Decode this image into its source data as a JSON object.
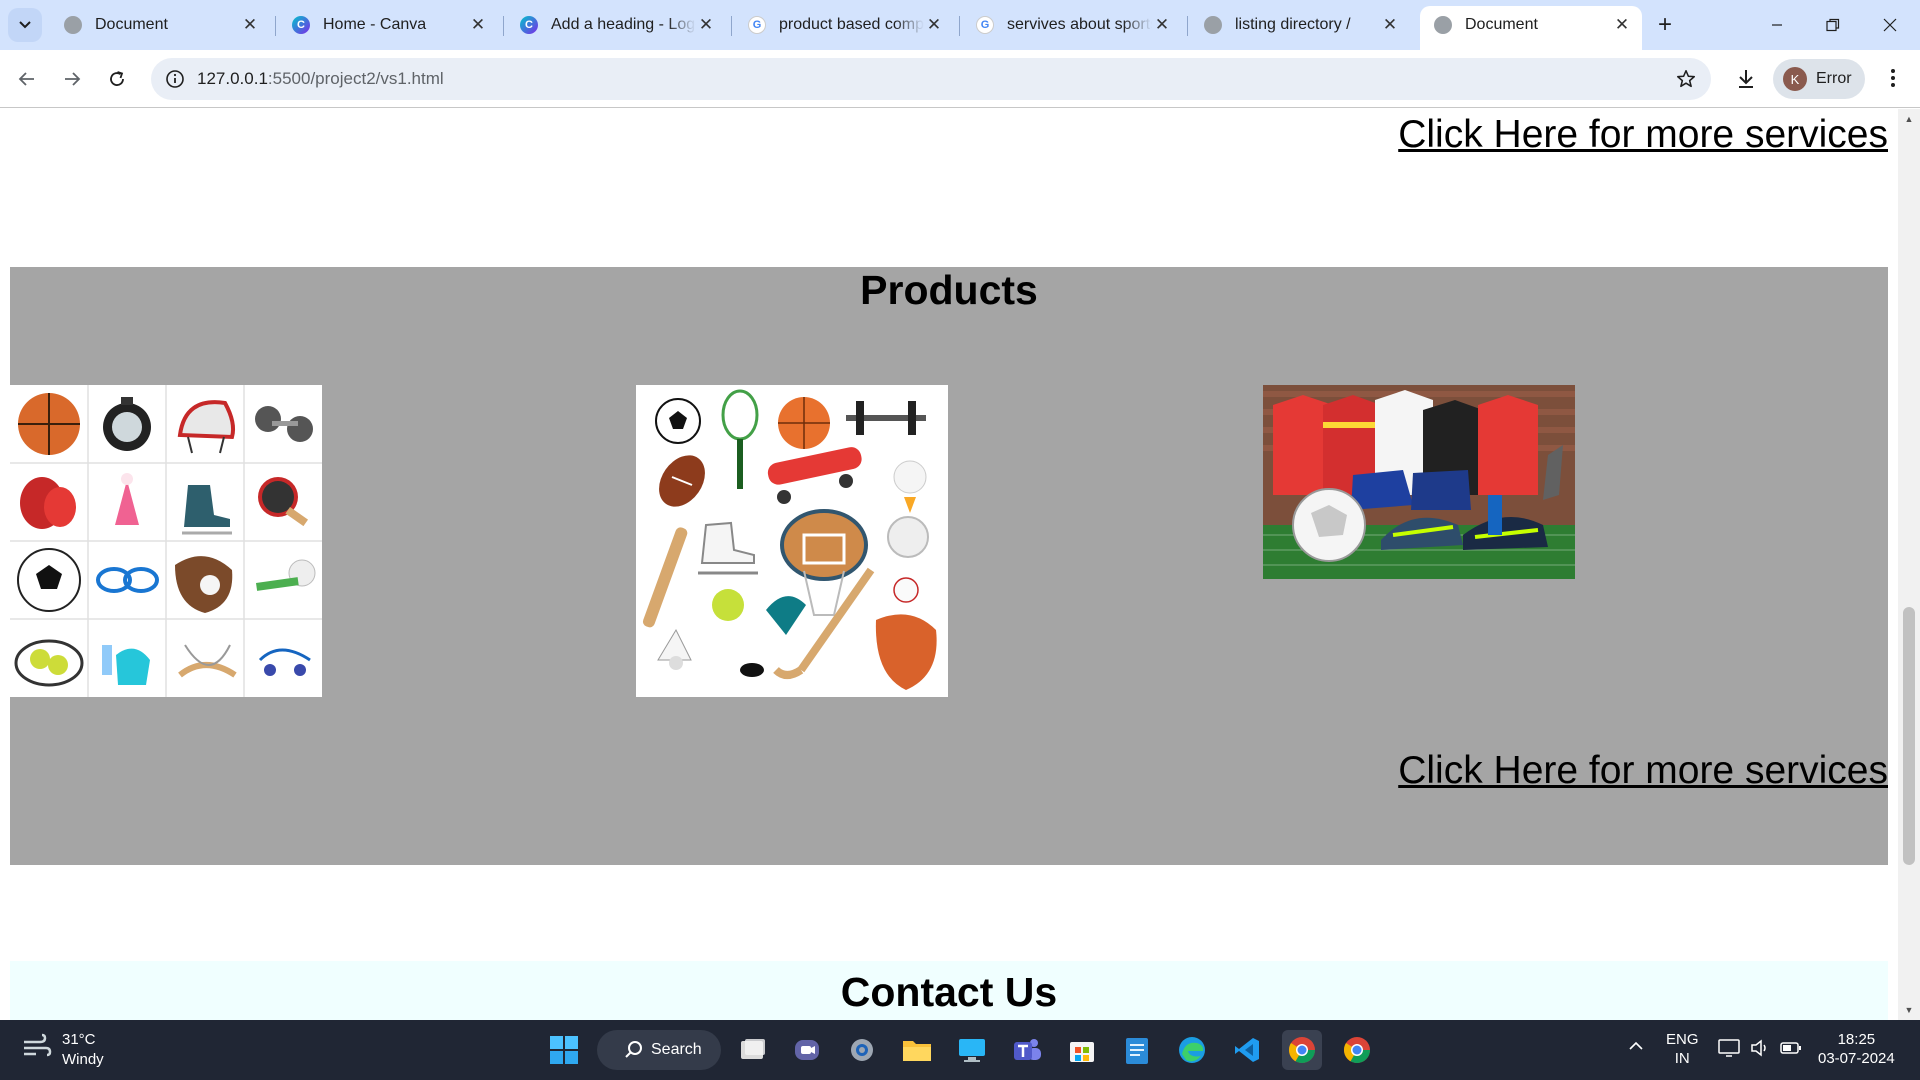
{
  "tabs": [
    {
      "title": "Document",
      "favicon": "globe-icon"
    },
    {
      "title": "Home - Canva",
      "favicon": "canva-icon"
    },
    {
      "title": "Add a heading - Logo",
      "favicon": "canva-icon"
    },
    {
      "title": "product based comp",
      "favicon": "google-icon"
    },
    {
      "title": "servives about sports",
      "favicon": "google-icon"
    },
    {
      "title": "listing directory /",
      "favicon": "globe-icon"
    },
    {
      "title": "Document",
      "favicon": "globe-icon",
      "active": true
    }
  ],
  "omnibox": {
    "host": "127.0.0.1",
    "path": ":5500/project2/vs1.html"
  },
  "profile": {
    "initial": "K",
    "label": "Error"
  },
  "page": {
    "link_top": "Click Here for more services",
    "products_heading": "Products",
    "link_bottom": "Click Here for more services",
    "contact_heading": "Contact Us"
  },
  "taskbar": {
    "weather_temp": "31°C",
    "weather_desc": "Windy",
    "search_label": "Search",
    "lang_top": "ENG",
    "lang_bottom": "IN",
    "time": "18:25",
    "date": "03-07-2024"
  }
}
